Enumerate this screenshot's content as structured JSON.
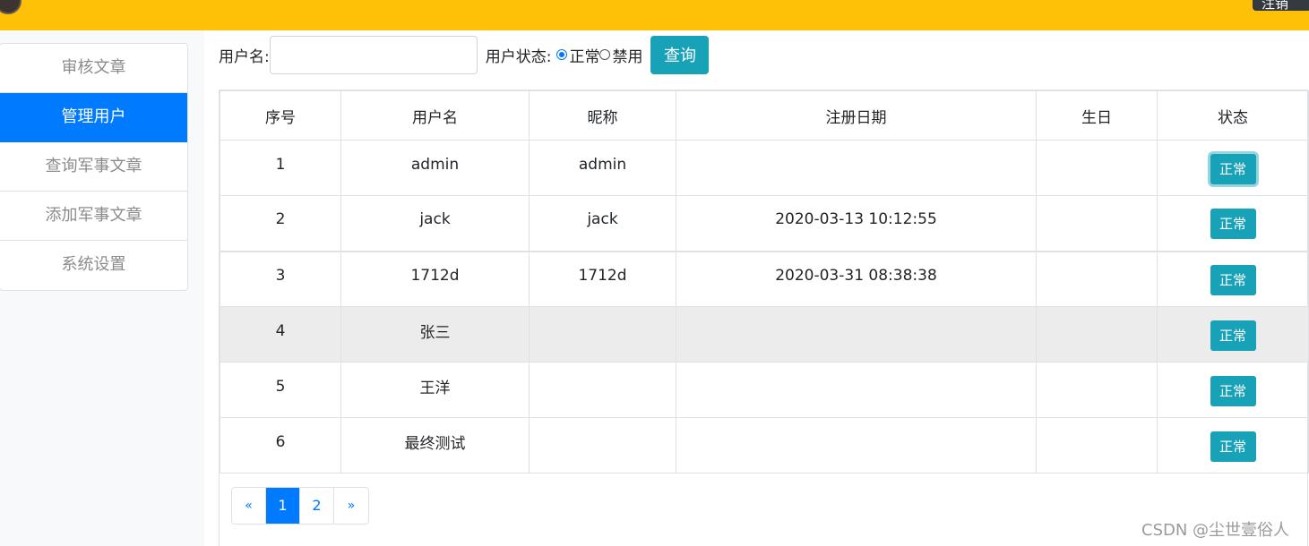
{
  "header": {
    "logout_label": "注销"
  },
  "sidebar": {
    "items": [
      {
        "label": "审核文章",
        "active": false
      },
      {
        "label": "管理用户",
        "active": true
      },
      {
        "label": "查询军事文章",
        "active": false
      },
      {
        "label": "添加军事文章",
        "active": false
      },
      {
        "label": "系统设置",
        "active": false
      }
    ]
  },
  "search": {
    "username_label": "用户名:",
    "username_value": "",
    "status_label": "用户状态:",
    "option_normal": "正常",
    "option_disabled": "禁用",
    "selected": "正常",
    "query_button": "查询"
  },
  "table": {
    "headers": [
      "序号",
      "用户名",
      "昵称",
      "注册日期",
      "生日",
      "状态"
    ],
    "rows": [
      {
        "no": "1",
        "username": "admin",
        "nickname": "admin",
        "reg_date": "",
        "birthday": "",
        "status": "正常"
      },
      {
        "no": "2",
        "username": "jack",
        "nickname": "jack",
        "reg_date": "2020-03-13 10:12:55",
        "birthday": "",
        "status": "正常"
      },
      {
        "no": "3",
        "username": "1712d",
        "nickname": "1712d",
        "reg_date": "2020-03-31 08:38:38",
        "birthday": "",
        "status": "正常"
      },
      {
        "no": "4",
        "username": "张三",
        "nickname": "",
        "reg_date": "",
        "birthday": "",
        "status": "正常"
      },
      {
        "no": "5",
        "username": "王洋",
        "nickname": "",
        "reg_date": "",
        "birthday": "",
        "status": "正常"
      },
      {
        "no": "6",
        "username": "最终测试",
        "nickname": "",
        "reg_date": "",
        "birthday": "",
        "status": "正常"
      }
    ]
  },
  "pagination": {
    "prev": "«",
    "pages": [
      "1",
      "2"
    ],
    "current": "1",
    "next": "»"
  },
  "watermark": "CSDN @尘世壹俗人",
  "colors": {
    "topbar": "#ffc107",
    "primary": "#007bff",
    "info": "#17a2b8"
  }
}
